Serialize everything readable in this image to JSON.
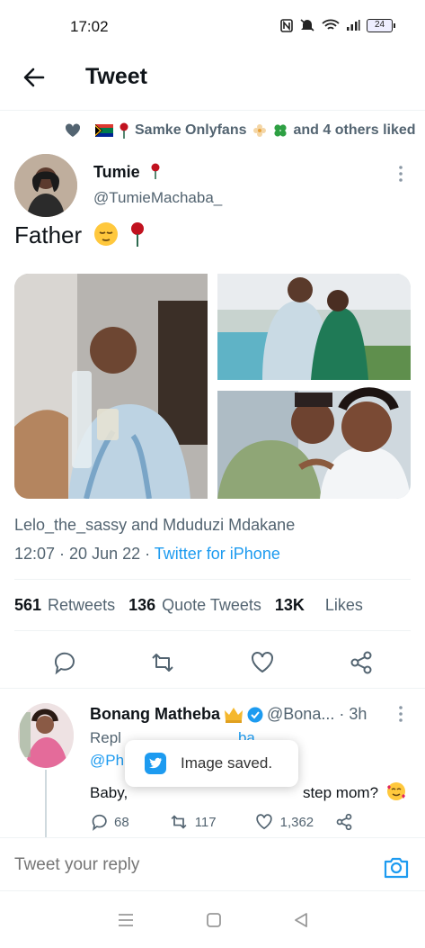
{
  "status_bar": {
    "time": "17:02",
    "battery": "24"
  },
  "header": {
    "title": "Tweet"
  },
  "social_context": {
    "text": "Samke Onlyfans",
    "suffix": "and 4 others liked"
  },
  "tweet": {
    "author_name": "Tumie",
    "author_handle": "@TumieMachaba_",
    "text": "Father",
    "liked_by": "Lelo_the_sassy and Mduduzi Mdakane",
    "timestamp": "12:07 · 20 Jun 22 · ",
    "source": "Twitter for iPhone",
    "stats": {
      "retweets_count": "561",
      "retweets_label": "Retweets",
      "quotes_count": "136",
      "quotes_label": "Quote Tweets",
      "likes_count": "13K",
      "likes_label": "Likes"
    }
  },
  "reply": {
    "author_name": "Bonang Matheba",
    "author_handle": "@Bona... · 3h",
    "replying_prefix": "Repl",
    "replying_mention": "ba_",
    "mention2": "@Ph",
    "text": "Baby, ",
    "text_end": "step mom?",
    "reply_count": "68",
    "retweet_count": "117",
    "like_count": "1,362"
  },
  "toast": {
    "text": "Image saved."
  },
  "compose": {
    "placeholder": "Tweet your reply"
  },
  "colors": {
    "accent": "#1d9bf0",
    "secondary_text": "#536471",
    "divider": "#eff3f4"
  }
}
